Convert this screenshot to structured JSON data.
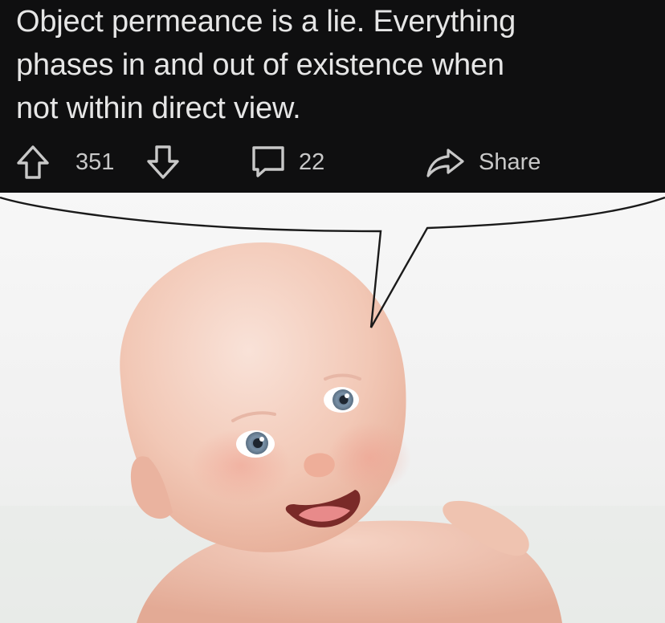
{
  "post": {
    "title": "Object permeance is a lie. Everything phases in and out of existence when not within direct view.",
    "line1": "Object permeance is a lie. Everything",
    "line2": "phases in and out of existence when",
    "line3": "not within direct view."
  },
  "actions": {
    "upvote_count": "351",
    "comment_count": "22",
    "share_label": "Share"
  },
  "icons": {
    "upvote": "arrow-up-icon",
    "downvote": "arrow-down-icon",
    "comment": "comment-bubble-icon",
    "share": "share-arrow-icon"
  },
  "colors": {
    "header_background": "#0f0f10",
    "text": "#e6e6e6",
    "icon": "#c8c8c8"
  },
  "image": {
    "subject": "smiling-baby-photo",
    "speech_bubble": true
  }
}
